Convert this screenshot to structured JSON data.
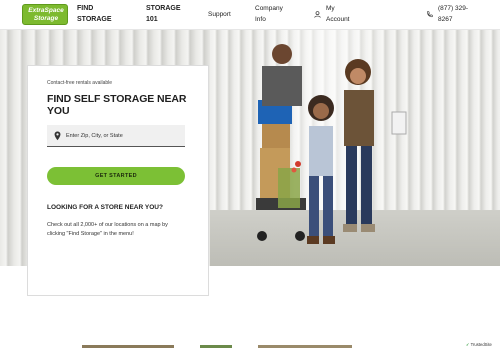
{
  "header": {
    "logo_line1": "ExtraSpace",
    "logo_line2": "Storage",
    "nav": {
      "find_storage_line1": "FIND",
      "find_storage_line2": "STORAGE",
      "storage101_line1": "STORAGE",
      "storage101_line2": "101",
      "support": "Support",
      "company_line1": "Company",
      "company_line2": "Info",
      "account_line1": "My",
      "account_line2": "Account",
      "phone_line1": "(877) 329-",
      "phone_line2": "8267"
    }
  },
  "card": {
    "subtitle": "Contact-free rentals available",
    "title": "FIND SELF STORAGE NEAR YOU",
    "search_placeholder": "Enter Zip, City, or State",
    "cta_label": "GET STARTED",
    "heading2": "LOOKING FOR A STORE NEAR YOU?",
    "body": "Check out all 2,000+ of our locations on a map by clicking \"Find Storage\" in the menu!"
  },
  "footer": {
    "trusted_label": "TrustedSite"
  },
  "colors": {
    "brand_green": "#7cc035",
    "logo_green": "#7dba2f"
  }
}
